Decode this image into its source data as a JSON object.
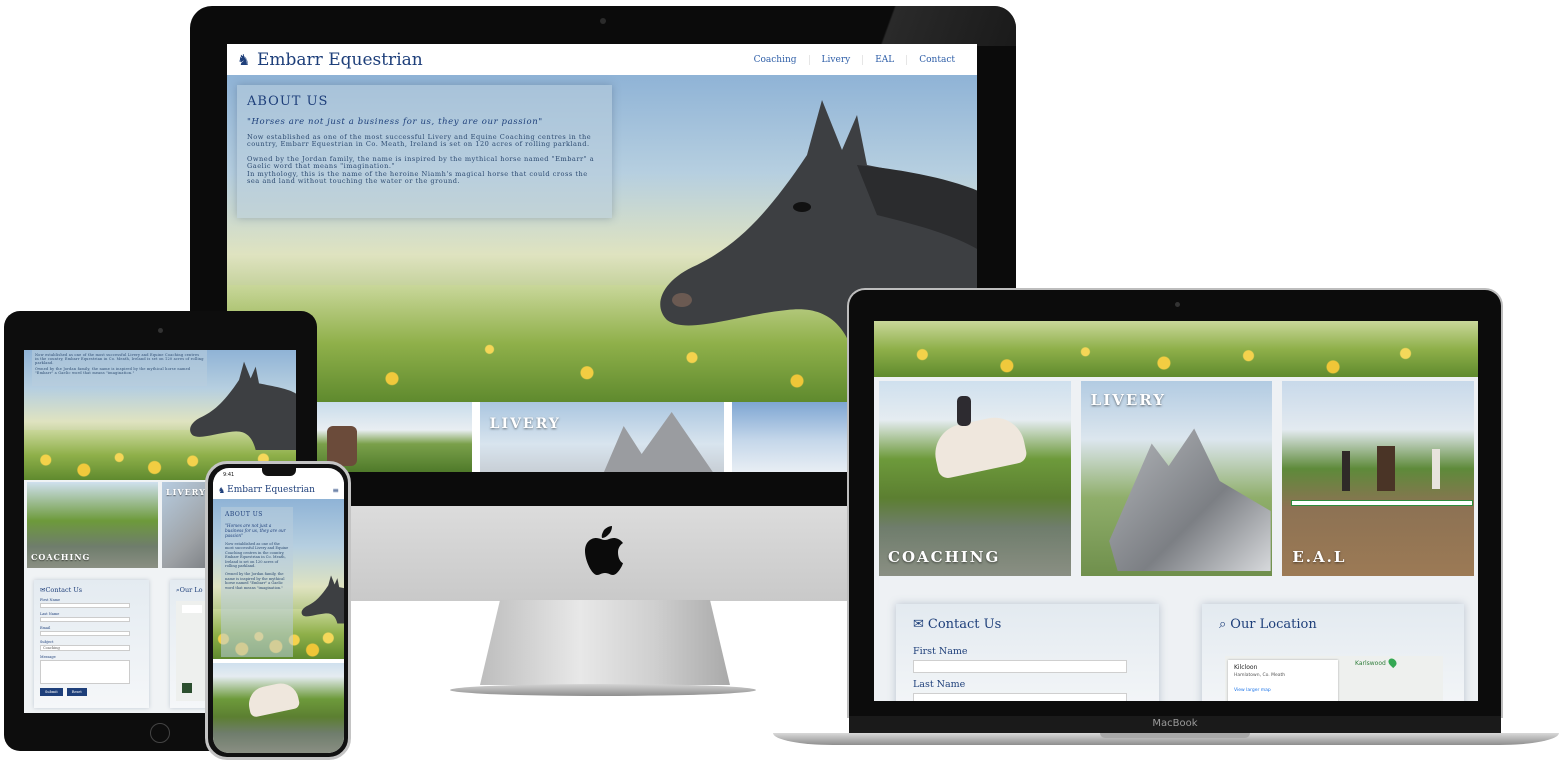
{
  "site": {
    "brand": "Embarr Equestrian",
    "nav": [
      "Coaching",
      "Livery",
      "EAL",
      "Contact"
    ]
  },
  "about": {
    "title": "ABOUT US",
    "quote": "\"Horses are not just a business for us, they are our passion\"",
    "p1": "Now established as one of the most successful Livery and Equine Coaching centres in the country, Embarr Equestrian in Co. Meath, Ireland is set on 120 acres of rolling parkland.",
    "p2": "Owned by the Jordan family, the name is inspired by the mythical horse named \"Embarr\" a Gaelic word that means \"imagination.\"",
    "p3": "In mythology, this is the name of the heroine Niamh's magical horse that could cross the sea and land without touching the water or the ground."
  },
  "cards": {
    "coaching": "COACHING",
    "livery": "LIVERY",
    "eal": "E.A.L"
  },
  "contact": {
    "title": "Contact Us",
    "first_name": "First Name",
    "last_name": "Last Name",
    "email": "Email",
    "subject": "Subject",
    "subject_value": "Coaching",
    "message": "Message",
    "submit": "Submit",
    "reset": "Reset"
  },
  "location": {
    "title": "Our Location",
    "tablet_title": "Our Lo",
    "place": "Kilcloon",
    "address": "Hamlatown, Co. Meath",
    "map_link": "View larger map",
    "nearby": "Karlswood"
  },
  "phone": {
    "time": "9:41"
  },
  "device": {
    "laptop_label": "MacBook"
  },
  "colors": {
    "brand_blue": "#1e3f7a",
    "nav_link": "#2f5fa8",
    "button": "#1e3f7a"
  },
  "icons": {
    "brand": "horse-head-icon",
    "contact": "envelope-icon",
    "location": "search-location-icon",
    "menu": "hamburger-icon",
    "apple": "apple-logo-icon"
  }
}
